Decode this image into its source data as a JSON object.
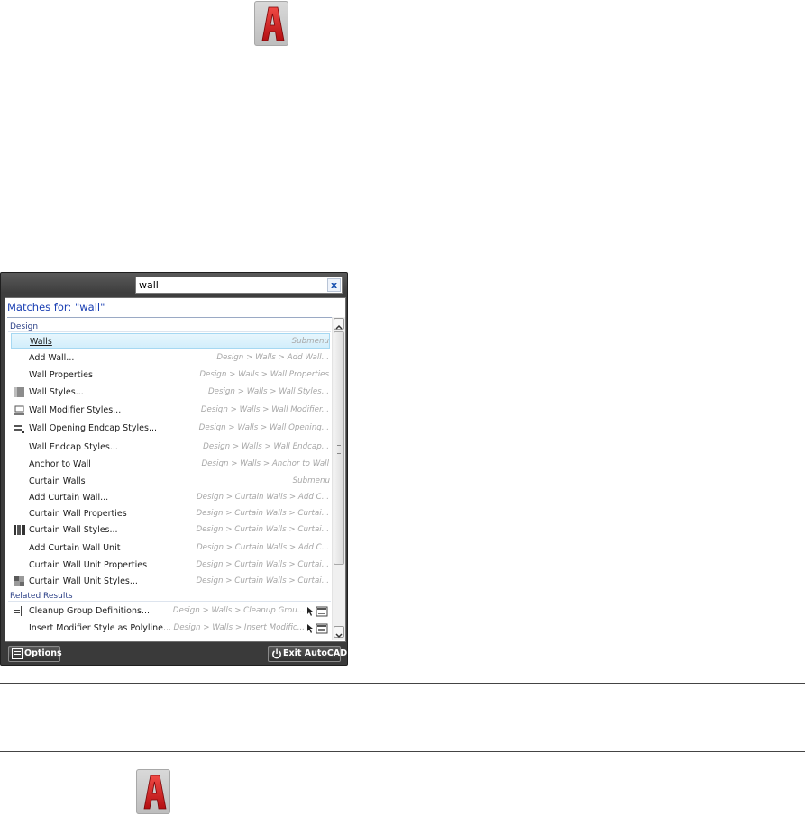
{
  "search": {
    "value": "wall",
    "clear_label": "x"
  },
  "matches_header": "Matches for: \"wall\"",
  "groups": [
    {
      "label": "Design"
    },
    {
      "label": "Related Results"
    }
  ],
  "rows": [
    {
      "label": "Walls",
      "path": "Submenu",
      "icon": "none",
      "submenu": true,
      "selected": true
    },
    {
      "label": "Add Wall...",
      "path": "Design > Walls > Add Wall...",
      "icon": "none"
    },
    {
      "label": "Wall Properties",
      "path": "Design > Walls > Wall Properties",
      "icon": "none"
    },
    {
      "label": "Wall Styles...",
      "path": "Design > Walls > Wall Styles...",
      "icon": "wall-style-icon"
    },
    {
      "label": "Wall Modifier Styles...",
      "path": "Design > Walls > Wall Modifier...",
      "icon": "wall-modifier-icon"
    },
    {
      "label": "Wall Opening Endcap Styles...",
      "path": "Design > Walls > Wall Opening...",
      "icon": "wall-opening-endcap-icon"
    },
    {
      "label": "Wall Endcap Styles...",
      "path": "Design > Walls > Wall Endcap...",
      "icon": "none"
    },
    {
      "label": "Anchor to Wall",
      "path": "Design > Walls > Anchor to Wall",
      "icon": "none"
    },
    {
      "label": "Curtain Walls",
      "path": "Submenu",
      "icon": "none",
      "submenu": true
    },
    {
      "label": "Add Curtain Wall...",
      "path": "Design > Curtain Walls > Add C...",
      "icon": "none"
    },
    {
      "label": "Curtain Wall Properties",
      "path": "Design > Curtain Walls > Curtai...",
      "icon": "none"
    },
    {
      "label": "Curtain Wall Styles...",
      "path": "Design > Curtain Walls > Curtai...",
      "icon": "curtain-wall-style-icon"
    },
    {
      "label": "Add Curtain Wall Unit",
      "path": "Design > Curtain Walls > Add C...",
      "icon": "none"
    },
    {
      "label": "Curtain Wall Unit Properties",
      "path": "Design > Curtain Walls > Curtai...",
      "icon": "none"
    },
    {
      "label": "Curtain Wall Unit Styles...",
      "path": "Design > Curtain Walls > Curtai...",
      "icon": "curtain-wall-unit-style-icon"
    },
    {
      "label": "Cleanup Group Definitions...",
      "path": "Design > Walls > Cleanup Grou...",
      "icon": "cleanup-group-icon"
    },
    {
      "label": "Insert Modifier Style as Polyline...",
      "path": "Design > Walls > Insert Modific...",
      "icon": "none"
    }
  ],
  "footer": {
    "options_label": "Options",
    "exit_label": "Exit AutoCAD"
  },
  "colors": {
    "accent": "#1a3fb3",
    "selection": "#d2eefb",
    "logo_red": "#d7161b",
    "frame": "#3a3a3a"
  }
}
